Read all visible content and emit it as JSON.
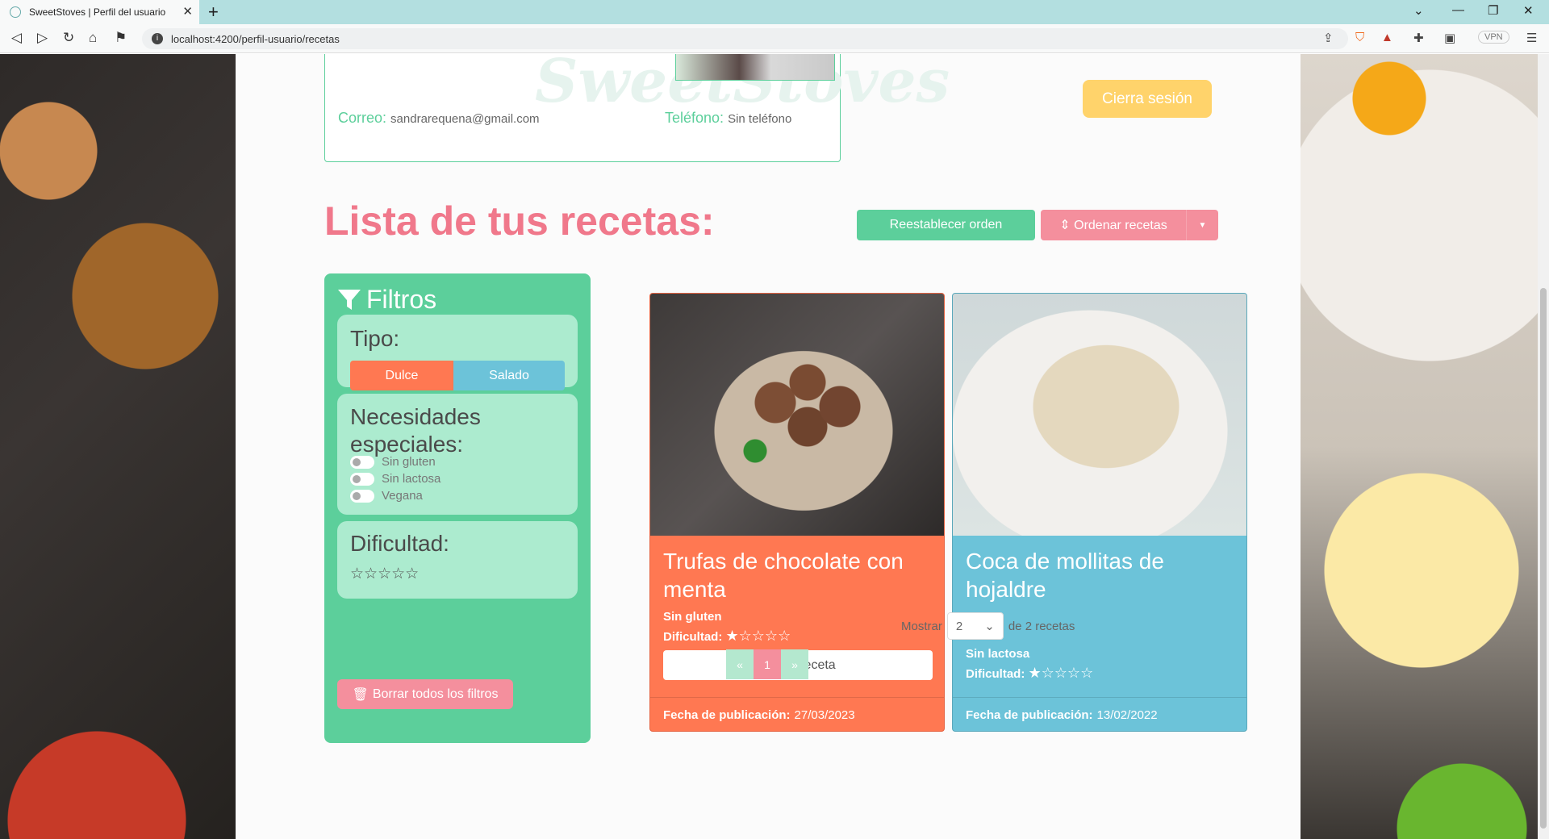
{
  "browser": {
    "tab_title": "SweetStoves | Perfil del usuario",
    "url": "localhost:4200/perfil-usuario/recetas",
    "vpn_label": "VPN"
  },
  "profile": {
    "watermark": "SweetStoves",
    "email_label": "Correo:",
    "email_value": "sandrarequena@gmail.com",
    "phone_label": "Teléfono:",
    "phone_value": "Sin teléfono",
    "logout_label": "Cierra sesión"
  },
  "recipes_header": {
    "title": "Lista de tus recetas:",
    "reset_label": "Reestablecer orden",
    "order_label": "⇕ Ordenar recetas"
  },
  "filters": {
    "title": "Filtros",
    "type_label": "Tipo:",
    "type_options": [
      "Dulce",
      "Salado"
    ],
    "needs_label": "Necesidades especiales:",
    "needs_options": [
      "Sin gluten",
      "Sin lactosa",
      "Vegana"
    ],
    "difficulty_label": "Dificultad:",
    "difficulty_stars": "☆☆☆☆☆",
    "clear_label": "Borrar todos los filtros"
  },
  "recipes": [
    {
      "title": "Trufas de chocolate con menta",
      "tag": "Sin gluten",
      "difficulty_label": "Dificultad:",
      "difficulty_stars": "★☆☆☆☆",
      "delete_label": "Borrar receta",
      "date_label": "Fecha de publicación:",
      "date_value": "27/03/2023"
    },
    {
      "title": "Coca de mollitas de hojaldre",
      "tag": "Sin lactosa",
      "difficulty_label": "Dificultad:",
      "difficulty_stars": "★☆☆☆☆",
      "date_label": "Fecha de publicación:",
      "date_value": "13/02/2022"
    }
  ],
  "pagination": {
    "show_label": "Mostrar",
    "page_size": "2",
    "total_label": "de 2 recetas",
    "prev": "«",
    "current": "1",
    "next": "»"
  }
}
